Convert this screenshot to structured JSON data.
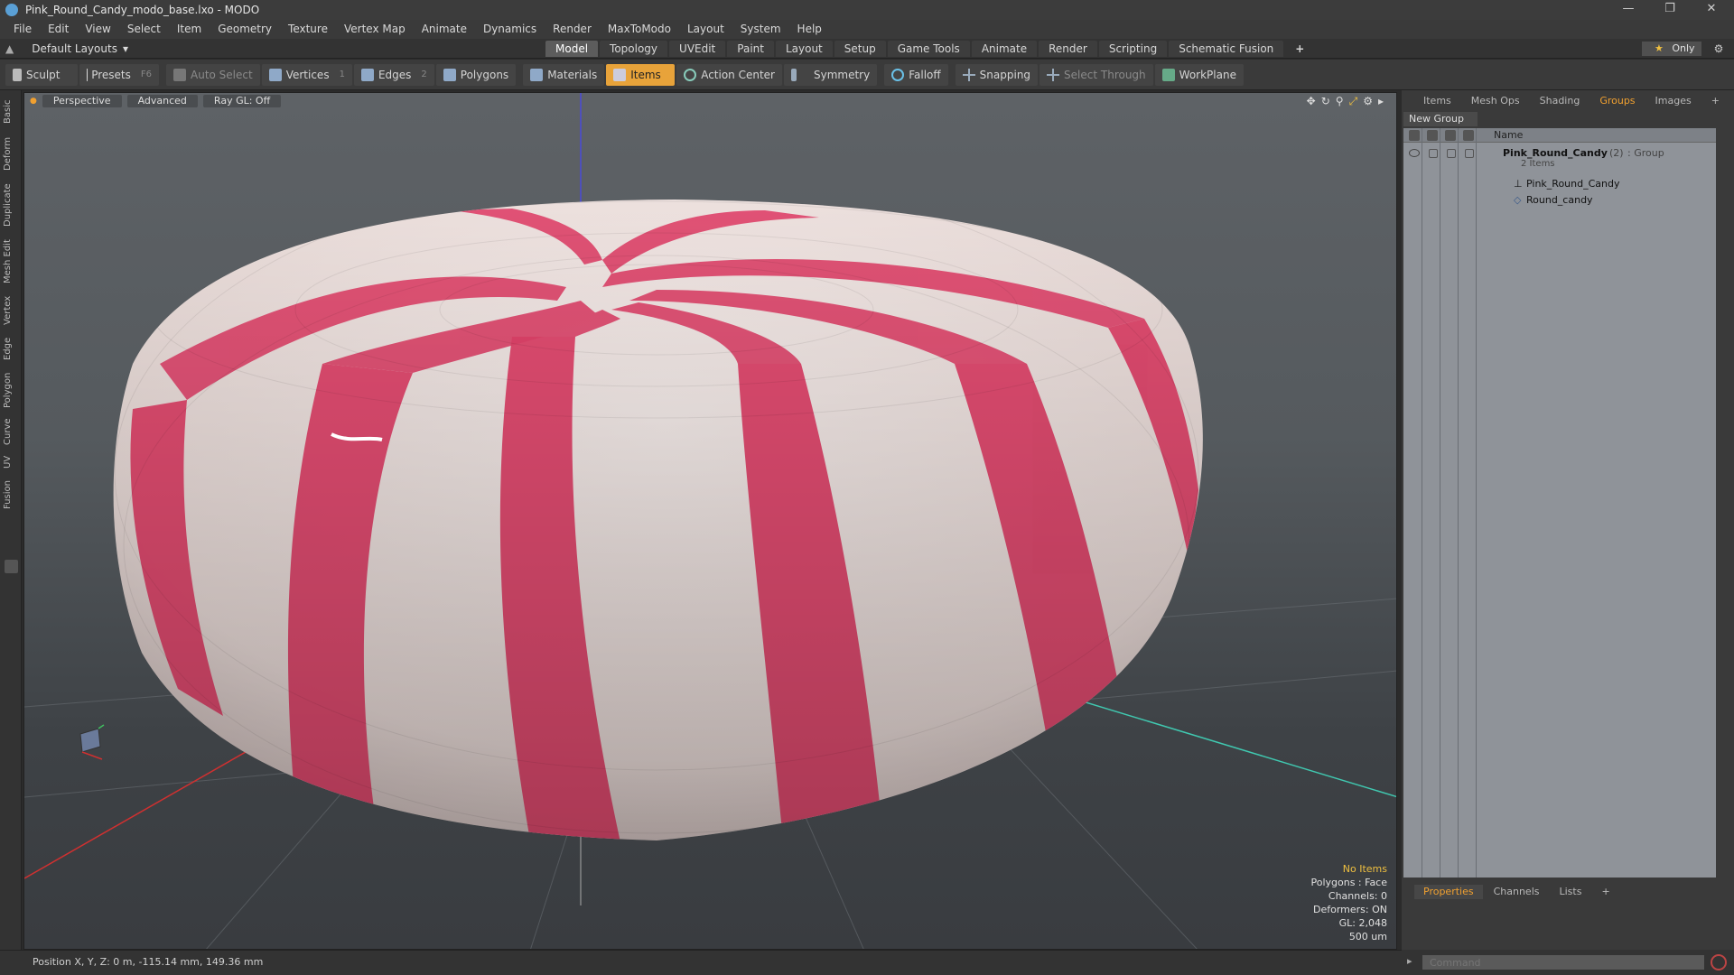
{
  "window": {
    "title": "Pink_Round_Candy_modo_base.lxo - MODO",
    "controls": [
      "—",
      "❐",
      "✕"
    ]
  },
  "menu": [
    "File",
    "Edit",
    "View",
    "Select",
    "Item",
    "Geometry",
    "Texture",
    "Vertex Map",
    "Animate",
    "Dynamics",
    "Render",
    "MaxToModo",
    "Layout",
    "System",
    "Help"
  ],
  "layout": {
    "selector": "Default Layouts",
    "arrow": "▾"
  },
  "tabs": [
    {
      "label": "Model",
      "active": true
    },
    {
      "label": "Topology"
    },
    {
      "label": "UVEdit"
    },
    {
      "label": "Paint"
    },
    {
      "label": "Layout"
    },
    {
      "label": "Setup"
    },
    {
      "label": "Game Tools"
    },
    {
      "label": "Animate"
    },
    {
      "label": "Render"
    },
    {
      "label": "Scripting"
    },
    {
      "label": "Schematic Fusion"
    },
    {
      "label": "+"
    }
  ],
  "only_button": {
    "label": "Only",
    "star": "★"
  },
  "toolbar": {
    "sculpt": "Sculpt",
    "presets": "Presets",
    "presets_key": "F6",
    "auto_select": "Auto Select",
    "vertices": "Vertices",
    "vertices_num": "1",
    "edges": "Edges",
    "edges_num": "2",
    "polygons": "Polygons",
    "materials": "Materials",
    "items": "Items",
    "action_center": "Action Center",
    "symmetry": "Symmetry",
    "falloff": "Falloff",
    "snapping": "Snapping",
    "select_through": "Select Through",
    "workplane": "WorkPlane"
  },
  "left_tabs": [
    "Basic",
    "Deform",
    "Duplicate",
    "Mesh Edit",
    "Vertex",
    "Edge",
    "Polygon",
    "Curve",
    "UV",
    "Fusion"
  ],
  "viewport": {
    "view": "Perspective",
    "shading": "Advanced",
    "raygl": "Ray GL: Off",
    "info": {
      "items": "No Items",
      "polygons": "Polygons : Face",
      "channels": "Channels: 0",
      "deformers": "Deformers: ON",
      "gl": "GL: 2,048",
      "scale": "500 um"
    }
  },
  "right_panel": {
    "tabs": [
      "Items",
      "Mesh Ops",
      "Shading",
      "Groups",
      "Images",
      "+"
    ],
    "active_tab": "Groups",
    "new_group": "New Group",
    "column_name": "Name",
    "group": {
      "name": "Pink_Round_Candy",
      "count": "(2)",
      "type": ": Group",
      "items_label": "2 Items",
      "children": [
        "Pink_Round_Candy",
        "Round_candy"
      ]
    },
    "bottom_tabs": [
      "Properties",
      "Channels",
      "Lists",
      "+"
    ],
    "bottom_active": "Properties"
  },
  "status": {
    "position": "Position X, Y, Z:  0 m, -115.14 mm, 149.36 mm"
  },
  "command": {
    "placeholder": "Command"
  },
  "colors": {
    "accent_orange": "#e8a33a",
    "candy_pink": "#e0436a",
    "candy_white": "#f2e8e6"
  }
}
